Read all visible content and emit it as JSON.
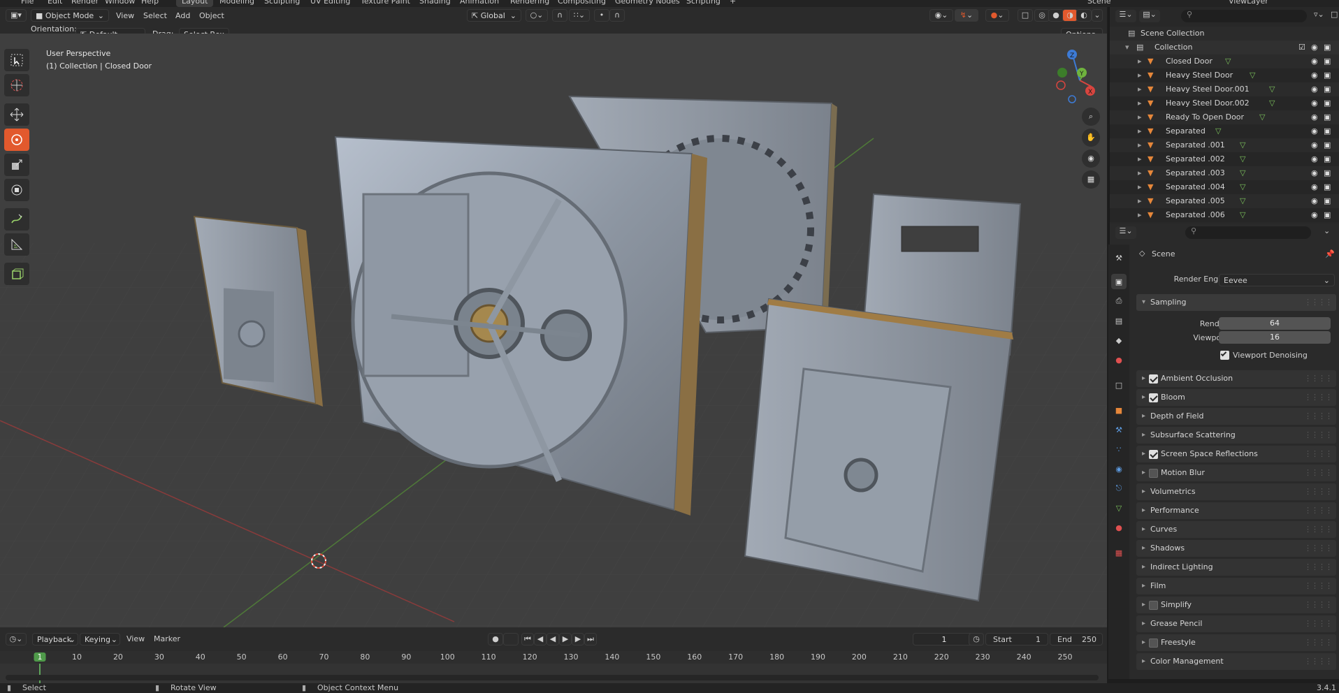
{
  "topbar": {
    "menus": [
      "File",
      "Edit",
      "Render",
      "Window",
      "Help"
    ],
    "workspaces": [
      "Layout",
      "Modeling",
      "Sculpting",
      "UV Editing",
      "Texture Paint",
      "Shading",
      "Animation",
      "Rendering",
      "Compositing",
      "Geometry Nodes",
      "Scripting"
    ],
    "active_workspace": "Layout",
    "scene_label": "Scene",
    "view_layer_label": "ViewLayer"
  },
  "viewport_header": {
    "mode": "Object Mode",
    "menus": [
      "View",
      "Select",
      "Add",
      "Object"
    ],
    "transform_orientation": "Global",
    "orientation_label": "Orientation:",
    "orientation_value": "Default",
    "drag_label": "Drag:",
    "drag_value": "Select Box",
    "options_label": "Options"
  },
  "viewport": {
    "perspective": "User Perspective",
    "collection_info": "(1) Collection | Closed Door",
    "gizmo_axes": [
      "X",
      "Y",
      "Z"
    ]
  },
  "outliner": {
    "root": "Scene Collection",
    "collection": "Collection",
    "items": [
      "Closed Door",
      "Heavy Steel Door",
      "Heavy Steel Door.001",
      "Heavy Steel Door.002",
      "Ready To Open Door",
      "Separated",
      "Separated .001",
      "Separated .002",
      "Separated .003",
      "Separated .004",
      "Separated .005",
      "Separated .006"
    ]
  },
  "properties": {
    "context": "Scene",
    "render_engine_label": "Render Engine",
    "render_engine": "Eevee",
    "sampling_label": "Sampling",
    "render_label": "Render",
    "render_samples": "64",
    "viewport_label": "Viewport",
    "viewport_samples": "16",
    "viewport_denoising_label": "Viewport Denoising",
    "viewport_denoising": true,
    "panels": [
      {
        "label": "Ambient Occlusion",
        "checkbox": true,
        "checked": true
      },
      {
        "label": "Bloom",
        "checkbox": true,
        "checked": true
      },
      {
        "label": "Depth of Field",
        "checkbox": false
      },
      {
        "label": "Subsurface Scattering",
        "checkbox": false
      },
      {
        "label": "Screen Space Reflections",
        "checkbox": true,
        "checked": true
      },
      {
        "label": "Motion Blur",
        "checkbox": true,
        "checked": false
      },
      {
        "label": "Volumetrics",
        "checkbox": false
      },
      {
        "label": "Performance",
        "checkbox": false
      },
      {
        "label": "Curves",
        "checkbox": false
      },
      {
        "label": "Shadows",
        "checkbox": false
      },
      {
        "label": "Indirect Lighting",
        "checkbox": false
      },
      {
        "label": "Film",
        "checkbox": false
      },
      {
        "label": "Simplify",
        "checkbox": true,
        "checked": false
      },
      {
        "label": "Grease Pencil",
        "checkbox": false
      },
      {
        "label": "Freestyle",
        "checkbox": true,
        "checked": false
      },
      {
        "label": "Color Management",
        "checkbox": false
      }
    ]
  },
  "timeline": {
    "playback": "Playback",
    "keying": "Keying",
    "view": "View",
    "marker": "Marker",
    "current_frame": "1",
    "start_label": "Start",
    "start": "1",
    "end_label": "End",
    "end": "250",
    "ticks": [
      "1",
      "10",
      "20",
      "30",
      "40",
      "50",
      "60",
      "70",
      "80",
      "90",
      "100",
      "110",
      "120",
      "130",
      "140",
      "150",
      "160",
      "170",
      "180",
      "190",
      "200",
      "210",
      "220",
      "230",
      "240",
      "250"
    ]
  },
  "statusbar": {
    "select": "Select",
    "rotate": "Rotate View",
    "context_menu": "Object Context Menu",
    "version": "3.4.1"
  },
  "colors": {
    "accent": "#e2592d",
    "viewport_bg": "#3f3f3f",
    "x_axis": "#d8453f",
    "y_axis": "#6fb33e",
    "z_axis": "#3d7bd6",
    "mesh_icon": "#e6873a",
    "vertex_icon": "#7cc35c"
  }
}
